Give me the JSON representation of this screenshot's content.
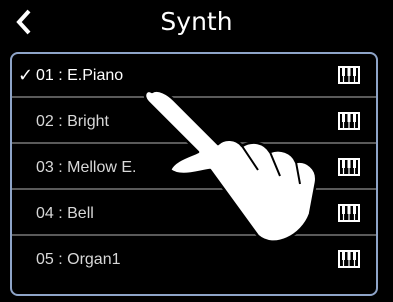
{
  "header": {
    "title": "Synth",
    "back_icon": "chevron-left-icon"
  },
  "list": {
    "items": [
      {
        "label": "01 : E.Piano",
        "selected": true,
        "check": "✓",
        "icon": "keyboard-icon"
      },
      {
        "label": "02 : Bright",
        "selected": false,
        "check": "",
        "icon": "keyboard-icon"
      },
      {
        "label": "03 : Mellow E.",
        "selected": false,
        "check": "",
        "icon": "keyboard-icon"
      },
      {
        "label": "04 : Bell",
        "selected": false,
        "check": "",
        "icon": "keyboard-icon"
      },
      {
        "label": "05 : Organ1",
        "selected": false,
        "check": "",
        "icon": "keyboard-icon"
      }
    ]
  },
  "overlay": {
    "icon": "tapping-hand-icon"
  },
  "colors": {
    "background": "#000000",
    "frame": "#8ea4c8",
    "text": "#ffffff",
    "separator": "#5a5a5a"
  }
}
